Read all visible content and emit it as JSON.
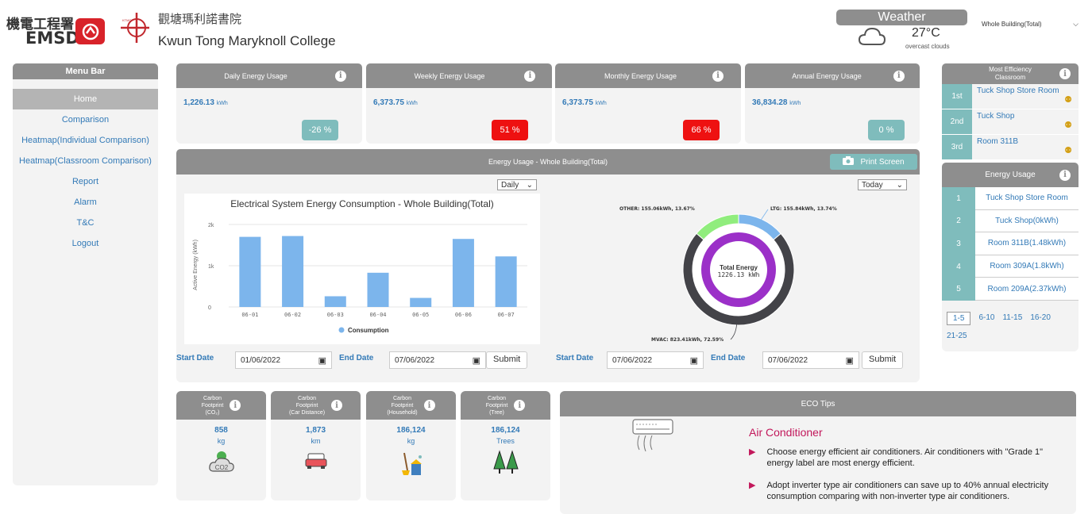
{
  "header": {
    "emsd_chinese": "機電工程署",
    "emsd_english": "EMSD",
    "school_chinese": "觀塘瑪利諾書院",
    "school_english": "Kwun Tong Maryknoll College",
    "weather_label": "Weather",
    "temperature": "27°C",
    "weather_desc": "overcast clouds",
    "building_select": "Whole Building(Total)"
  },
  "menu": {
    "title": "Menu Bar",
    "items": [
      "Home",
      "Comparison",
      "Heatmap(Individual Comparison)",
      "Heatmap(Classroom Comparison)",
      "Report",
      "Alarm",
      "T&C",
      "Logout"
    ]
  },
  "summary": [
    {
      "title": "Daily Energy Usage",
      "value": "1,226.13",
      "unit": "kWh",
      "change": "-26 %",
      "color": "#7fbcbc"
    },
    {
      "title": "Weekly Energy Usage",
      "value": "6,373.75",
      "unit": "kWh",
      "change": "51 %",
      "color": "#ee1111"
    },
    {
      "title": "Monthly Energy Usage",
      "value": "6,373.75",
      "unit": "kWh",
      "change": "66 %",
      "color": "#ee1111"
    },
    {
      "title": "Annual Energy Usage",
      "value": "36,834.28",
      "unit": "kWh",
      "change": "0 %",
      "color": "#7fbcbc"
    }
  ],
  "energy_panel": {
    "title": "Energy Usage - Whole Building(Total)",
    "print_label": "Print Screen",
    "period_select": "Daily",
    "range_select": "Today",
    "left_start_label": "Start Date",
    "left_start_value": "01/06/2022",
    "left_end_label": "End Date",
    "left_end_value": "07/06/2022",
    "right_start_label": "Start Date",
    "right_start_value": "07/06/2022",
    "right_end_label": "End Date",
    "right_end_value": "07/06/2022",
    "submit_label": "Submit"
  },
  "chart_data": [
    {
      "type": "bar",
      "title": "Electrical System Energy Consumption - Whole Building(Total)",
      "ylabel": "Active Energy (kWh)",
      "xlabel": "",
      "categories": [
        "06-01",
        "06-02",
        "06-03",
        "06-04",
        "06-05",
        "06-06",
        "06-07"
      ],
      "series": [
        {
          "name": "Consumption",
          "values": [
            1700,
            1720,
            260,
            830,
            220,
            1650,
            1226
          ]
        }
      ],
      "ylim": [
        0,
        2000
      ],
      "yticks": [
        "0",
        "1k",
        "2k"
      ],
      "color": "#7cb5ec",
      "legend_position": "bottom"
    },
    {
      "type": "pie",
      "center_label": "Total Energy",
      "center_value": "1226.13 kWh",
      "slices": [
        {
          "name": "LTG",
          "label": "LTG: 155.84kWh, 13.74%",
          "value": 155.84,
          "percent": 13.74,
          "color": "#7cb5ec"
        },
        {
          "name": "MVAC",
          "label": "MVAC: 823.41kWh, 72.59%",
          "value": 823.41,
          "percent": 72.59,
          "color": "#434348"
        },
        {
          "name": "OTHER",
          "label": "OTHER: 155.06kWh, 13.67%",
          "value": 155.06,
          "percent": 13.67,
          "color": "#90ed7d"
        }
      ],
      "inner_color": "#9b30c8"
    }
  ],
  "most_efficiency": {
    "title": "Most Efficiency Classroom",
    "rows": [
      {
        "rank": "1st",
        "name": "Tuck Shop Store Room"
      },
      {
        "rank": "2nd",
        "name": "Tuck Shop"
      },
      {
        "rank": "3rd",
        "name": "Room 311B"
      }
    ]
  },
  "energy_usage_rank": {
    "title": "Energy Usage",
    "rows": [
      {
        "rank": "1",
        "name": "Tuck Shop Store Room"
      },
      {
        "rank": "2",
        "name": "Tuck Shop(0kWh)"
      },
      {
        "rank": "3",
        "name": "Room 311B(1.48kWh)"
      },
      {
        "rank": "4",
        "name": "Room 309A(1.8kWh)"
      },
      {
        "rank": "5",
        "name": "Room 209A(2.37kWh)"
      }
    ],
    "pages": [
      "1-5",
      "6-10",
      "11-15",
      "16-20",
      "21-25"
    ]
  },
  "carbon": [
    {
      "title_lines": [
        "Carbon",
        "Footprint",
        "(CO₂)"
      ],
      "value": "858",
      "unit": "kg",
      "icon": "co2-cloud-icon"
    },
    {
      "title_lines": [
        "Carbon",
        "Footprint",
        "(Car Distance)"
      ],
      "value": "1,873",
      "unit": "km",
      "icon": "car-icon"
    },
    {
      "title_lines": [
        "Carbon",
        "Footprint",
        "(Household)"
      ],
      "value": "186,124",
      "unit": "kg",
      "icon": "household-icon"
    },
    {
      "title_lines": [
        "Carbon",
        "Footprint",
        "(Tree)"
      ],
      "value": "186,124",
      "unit": "Trees",
      "icon": "tree-icon"
    }
  ],
  "eco_tips": {
    "title": "ECO Tips",
    "heading": "Air Conditioner",
    "tips": [
      "Choose energy efficient air conditioners. Air conditioners with \"Grade 1\" energy label are most energy efficient.",
      "Adopt inverter type air conditioners can save up to 40% annual electricity consumption comparing with non-inverter type air conditioners."
    ]
  }
}
